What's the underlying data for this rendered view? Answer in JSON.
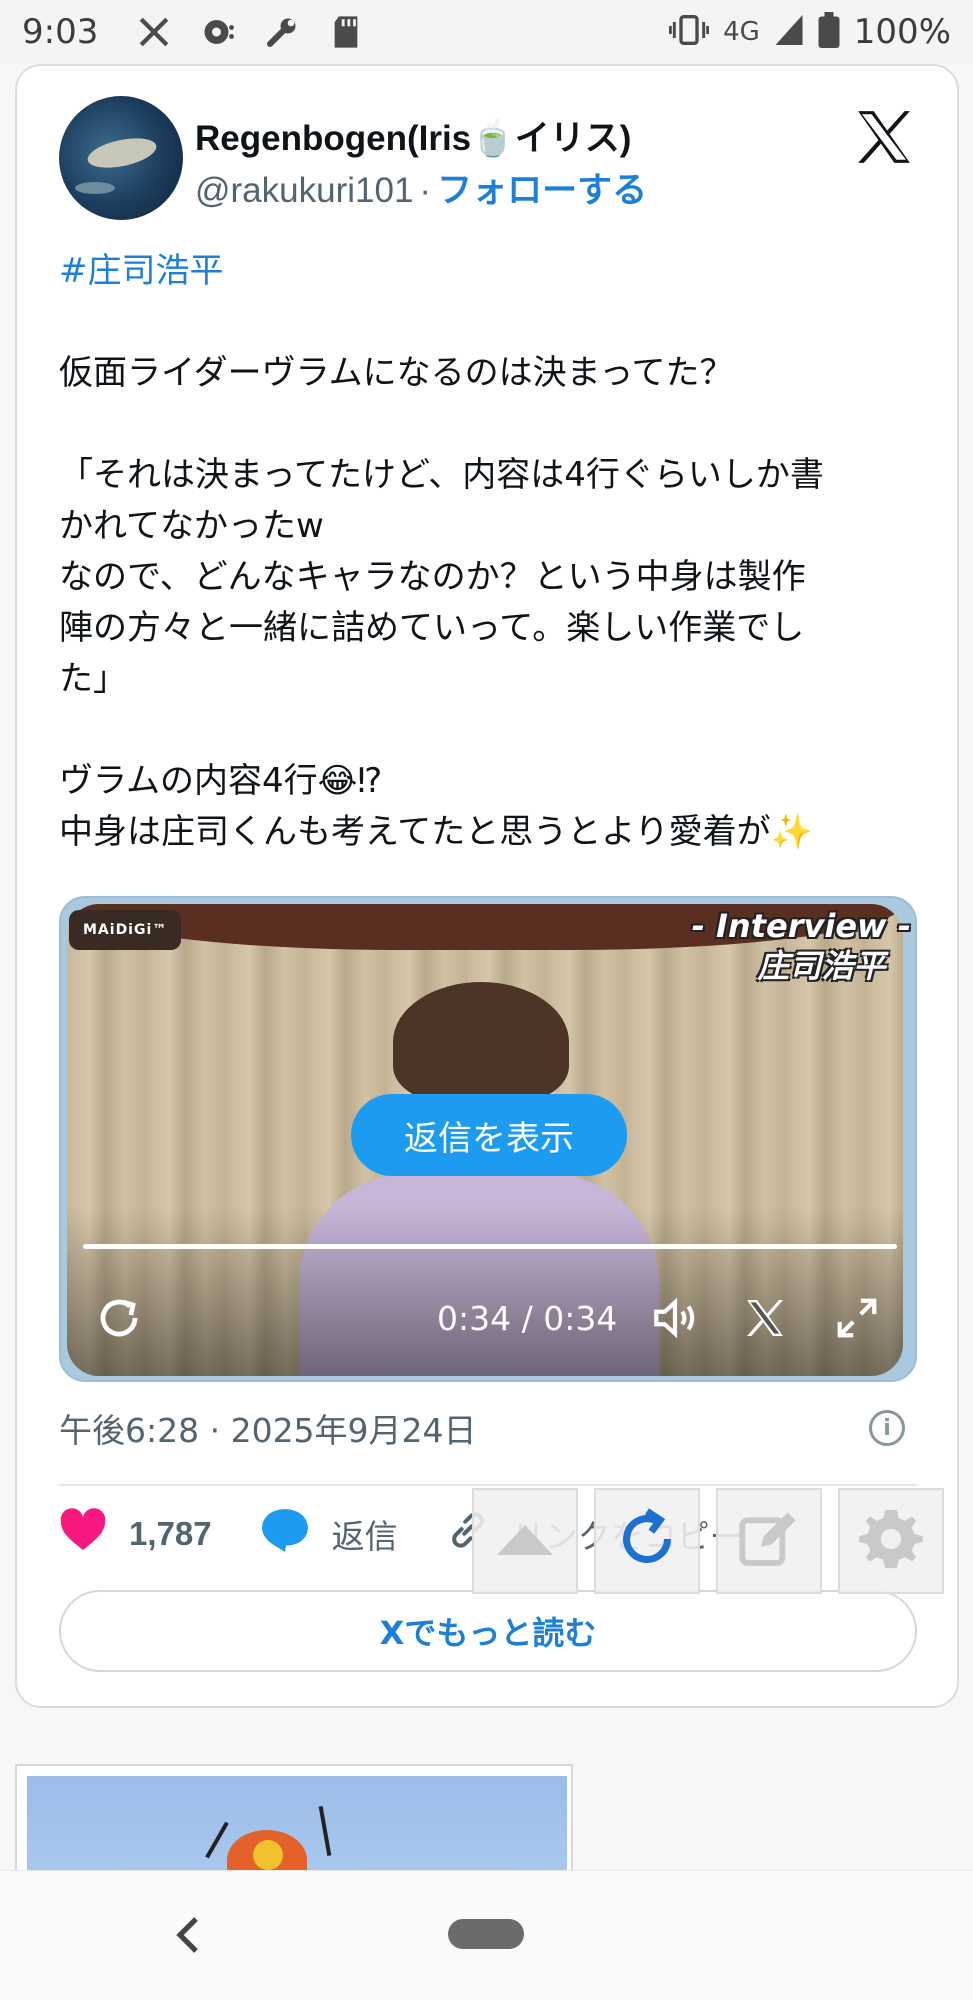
{
  "status_bar": {
    "time": "9:03",
    "network": "4G",
    "battery": "100%",
    "icons": [
      "x-icon",
      "chat-icon",
      "wrench-icon",
      "sd-card-icon",
      "vibrate-icon",
      "signal-icon",
      "battery-icon"
    ]
  },
  "tweet": {
    "author_name": "Regenbogen(Iris🍵イリス)",
    "handle": "@rakukuri101",
    "separator": "·",
    "follow_label": "フォローする",
    "hashtag": "#庄司浩平",
    "lines": [
      "",
      "仮面ライダーヴラムになるのは決まってた？",
      "",
      "「それは決まってたけど、内容は4行ぐらいしか書",
      "かれてなかったw",
      "なので、どんなキャラなのか？という中身は製作",
      "陣の方々と一緒に詰めていって。楽しい作業でし",
      "た」",
      "",
      "ヴラムの内容4行😂⁉",
      "中身は庄司くんも考えてたと思うとより愛着が✨"
    ],
    "video": {
      "channel_logo": "MAiDiGi™",
      "overlay_line1": "- Interview -",
      "overlay_line2": "庄司浩平",
      "show_replies_label": "返信を表示",
      "time_display": "0:34 / 0:34",
      "progress": 1.0
    },
    "timestamp": "午後6:28 · 2025年9月24日",
    "likes": "1,787",
    "reply_label": "返信",
    "copy_link_label": "リンクをコピー",
    "read_more_label": "Xでもっと読む"
  },
  "colors": {
    "accent": "#1d9bf0",
    "link": "#1d7fd8",
    "like": "#f91880"
  }
}
